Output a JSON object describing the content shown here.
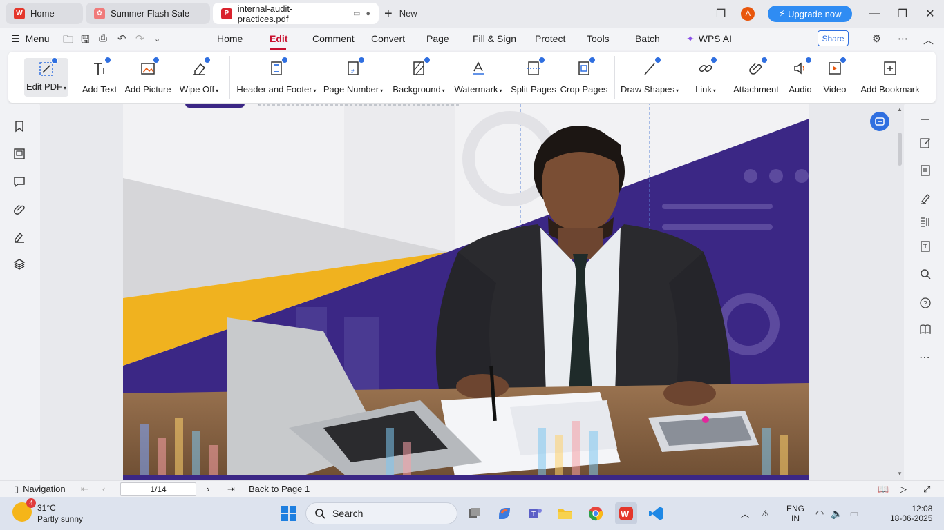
{
  "tabs": [
    {
      "label": "Home",
      "icon": "wps-logo-icon"
    },
    {
      "label": "Summer Flash Sale",
      "icon": "gift-icon"
    },
    {
      "label": "internal-audit-practices.pdf",
      "icon": "pdf-icon"
    }
  ],
  "new_tab": "New",
  "account": {
    "initial": "A",
    "upgrade": "Upgrade now"
  },
  "menu": {
    "menu_label": "Menu",
    "items": [
      "Home",
      "Edit",
      "Comment",
      "Convert",
      "Page",
      "Fill & Sign",
      "Protect",
      "Tools",
      "Batch",
      "WPS AI"
    ],
    "active": "Edit",
    "share": "Share"
  },
  "ribbon": [
    {
      "label": "Edit PDF",
      "icon": "edit-pdf-icon",
      "dropdown": true
    },
    {
      "label": "Add Text",
      "icon": "add-text-icon",
      "dropdown": false
    },
    {
      "label": "Add Picture",
      "icon": "add-picture-icon",
      "dropdown": false
    },
    {
      "label": "Wipe Off",
      "icon": "eraser-icon",
      "dropdown": true
    },
    {
      "label": "Header and Footer",
      "icon": "header-footer-icon",
      "dropdown": true
    },
    {
      "label": "Page Number",
      "icon": "page-number-icon",
      "dropdown": true
    },
    {
      "label": "Background",
      "icon": "background-icon",
      "dropdown": true
    },
    {
      "label": "Watermark",
      "icon": "watermark-icon",
      "dropdown": true
    },
    {
      "label": "Split Pages",
      "icon": "split-pages-icon",
      "dropdown": false
    },
    {
      "label": "Crop Pages",
      "icon": "crop-pages-icon",
      "dropdown": false
    },
    {
      "label": "Draw Shapes",
      "icon": "draw-shapes-icon",
      "dropdown": true
    },
    {
      "label": "Link",
      "icon": "link-icon",
      "dropdown": true
    },
    {
      "label": "Attachment",
      "icon": "attachment-icon",
      "dropdown": false
    },
    {
      "label": "Audio",
      "icon": "audio-icon",
      "dropdown": false
    },
    {
      "label": "Video",
      "icon": "video-icon",
      "dropdown": false
    },
    {
      "label": "Add Bookmark",
      "icon": "add-bookmark-icon",
      "dropdown": false
    }
  ],
  "statusbar": {
    "navigation": "Navigation",
    "page_indicator": "1/14",
    "back": "Back to Page 1"
  },
  "taskbar": {
    "weather_temp": "31°C",
    "weather_desc": "Partly sunny",
    "weather_badge": "4",
    "search": "Search",
    "lang": "ENG",
    "region": "IN",
    "time": "12:08",
    "date": "18-06-2025"
  },
  "colors": {
    "accent_red": "#c8102e",
    "accent_blue": "#2f6fe0",
    "doc_purple": "#3b2785",
    "doc_yellow": "#f0b21f"
  }
}
